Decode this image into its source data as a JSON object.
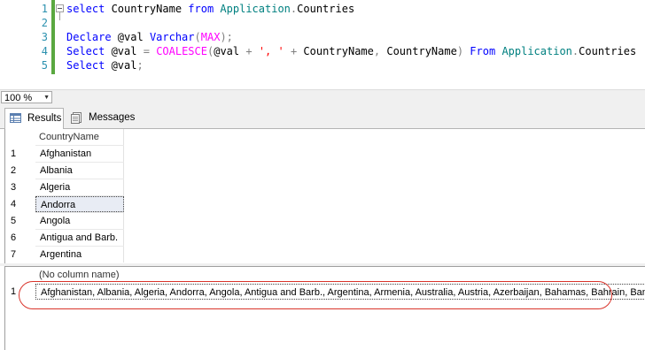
{
  "editor": {
    "line_numbers": [
      "1",
      "2",
      "3",
      "4",
      "5"
    ],
    "lines": [
      [
        {
          "t": "select",
          "c": "kw"
        },
        {
          "t": " CountryName ",
          "c": ""
        },
        {
          "t": "from",
          "c": "kw"
        },
        {
          "t": " ",
          "c": ""
        },
        {
          "t": "Application",
          "c": "obj"
        },
        {
          "t": ".",
          "c": "op"
        },
        {
          "t": "Countries",
          "c": ""
        }
      ],
      [],
      [
        {
          "t": "Declare",
          "c": "kw"
        },
        {
          "t": " @val ",
          "c": ""
        },
        {
          "t": "Varchar",
          "c": "kw"
        },
        {
          "t": "(",
          "c": "op"
        },
        {
          "t": "MAX",
          "c": "fn"
        },
        {
          "t": ");",
          "c": "op"
        }
      ],
      [
        {
          "t": "Select",
          "c": "kw"
        },
        {
          "t": " @val ",
          "c": ""
        },
        {
          "t": "=",
          "c": "op"
        },
        {
          "t": " ",
          "c": ""
        },
        {
          "t": "COALESCE",
          "c": "fn"
        },
        {
          "t": "(",
          "c": "op"
        },
        {
          "t": "@val ",
          "c": ""
        },
        {
          "t": "+",
          "c": "op"
        },
        {
          "t": " ",
          "c": ""
        },
        {
          "t": "', '",
          "c": "str"
        },
        {
          "t": " ",
          "c": ""
        },
        {
          "t": "+",
          "c": "op"
        },
        {
          "t": " CountryName",
          "c": ""
        },
        {
          "t": ",",
          "c": "op"
        },
        {
          "t": " CountryName",
          "c": ""
        },
        {
          "t": ")",
          "c": "op"
        },
        {
          "t": " ",
          "c": ""
        },
        {
          "t": "From",
          "c": "kw"
        },
        {
          "t": " ",
          "c": ""
        },
        {
          "t": "Application",
          "c": "obj"
        },
        {
          "t": ".",
          "c": "op"
        },
        {
          "t": "Countries",
          "c": ""
        }
      ],
      [
        {
          "t": "Select",
          "c": "kw"
        },
        {
          "t": " @val",
          "c": ""
        },
        {
          "t": ";",
          "c": "op"
        }
      ]
    ]
  },
  "zoom": {
    "value": "100 %"
  },
  "tabs": {
    "results": "Results",
    "messages": "Messages"
  },
  "grid1": {
    "header": "CountryName",
    "rows": [
      {
        "no": "1",
        "val": "Afghanistan"
      },
      {
        "no": "2",
        "val": "Albania"
      },
      {
        "no": "3",
        "val": "Algeria"
      },
      {
        "no": "4",
        "val": "Andorra"
      },
      {
        "no": "5",
        "val": "Angola"
      },
      {
        "no": "6",
        "val": "Antigua and Barb."
      },
      {
        "no": "7",
        "val": "Argentina"
      }
    ],
    "selected_row": "4"
  },
  "grid2": {
    "header": "(No column name)",
    "row_no": "1",
    "value": "Afghanistan, Albania, Algeria, Andorra, Angola, Antigua and Barb., Argentina, Armenia, Australia, Austria, Azerbaijan, Bahamas, Bahrain, Banglade"
  },
  "colors": {
    "keyword": "#0000ff",
    "function": "#ff00ff",
    "string": "#ff0000",
    "line_number": "#2b91af",
    "highlight_oval": "#d9342b"
  }
}
